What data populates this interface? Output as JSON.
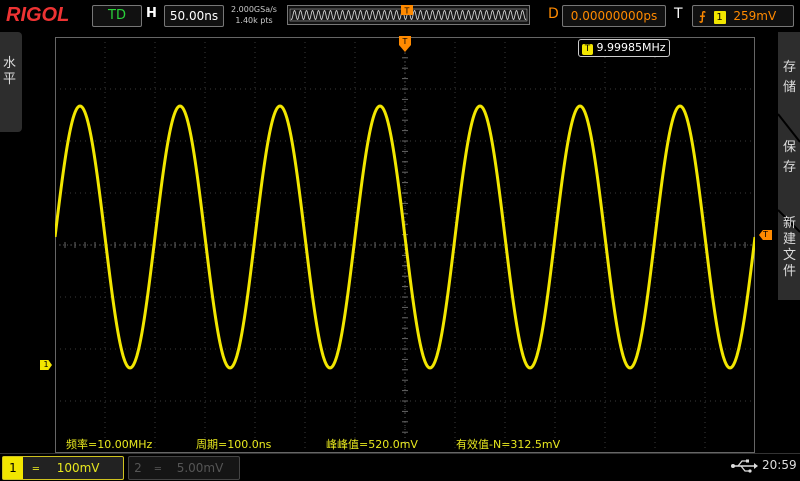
{
  "brand": "RIGOL",
  "topbar": {
    "run_state": "TD",
    "horizontal_label": "H",
    "timebase": "50.00ns",
    "sample_rate": "2.000GSa/s",
    "memory_depth": "1.40k pts",
    "delay_label": "D",
    "delay_value": "0.00000000ps",
    "trigger_label": "T",
    "trigger_source": "1",
    "trigger_level": "259mV"
  },
  "left_panel": {
    "label_line1": "水",
    "label_line2": "平"
  },
  "right_panel": {
    "items": [
      {
        "line1": "存",
        "line2": "储"
      },
      {
        "line1": "保",
        "line2": "存"
      },
      {
        "line1": "新",
        "line2": "建",
        "line3": "文",
        "line4": "件"
      }
    ]
  },
  "screen": {
    "frequency_counter": "9.99985MHz",
    "trigger_marker": "T",
    "channel_marker": "1",
    "trigger_level_marker": "T",
    "trace_color": "#f2e600",
    "waveform": {
      "type": "sine",
      "period_ns": 100.0,
      "peak_to_peak_mV": 520.0
    }
  },
  "measurements": [
    {
      "label": "频率=10.00MHz"
    },
    {
      "label": "周期=100.0ns"
    },
    {
      "label": "峰峰值=520.0mV"
    },
    {
      "label": "有效值-N=312.5mV"
    }
  ],
  "bottombar": {
    "ch1_number": "1",
    "ch1_scale": "100mV",
    "ch2_number": "2",
    "ch2_scale": "5.00mV",
    "clock": "20:59"
  }
}
